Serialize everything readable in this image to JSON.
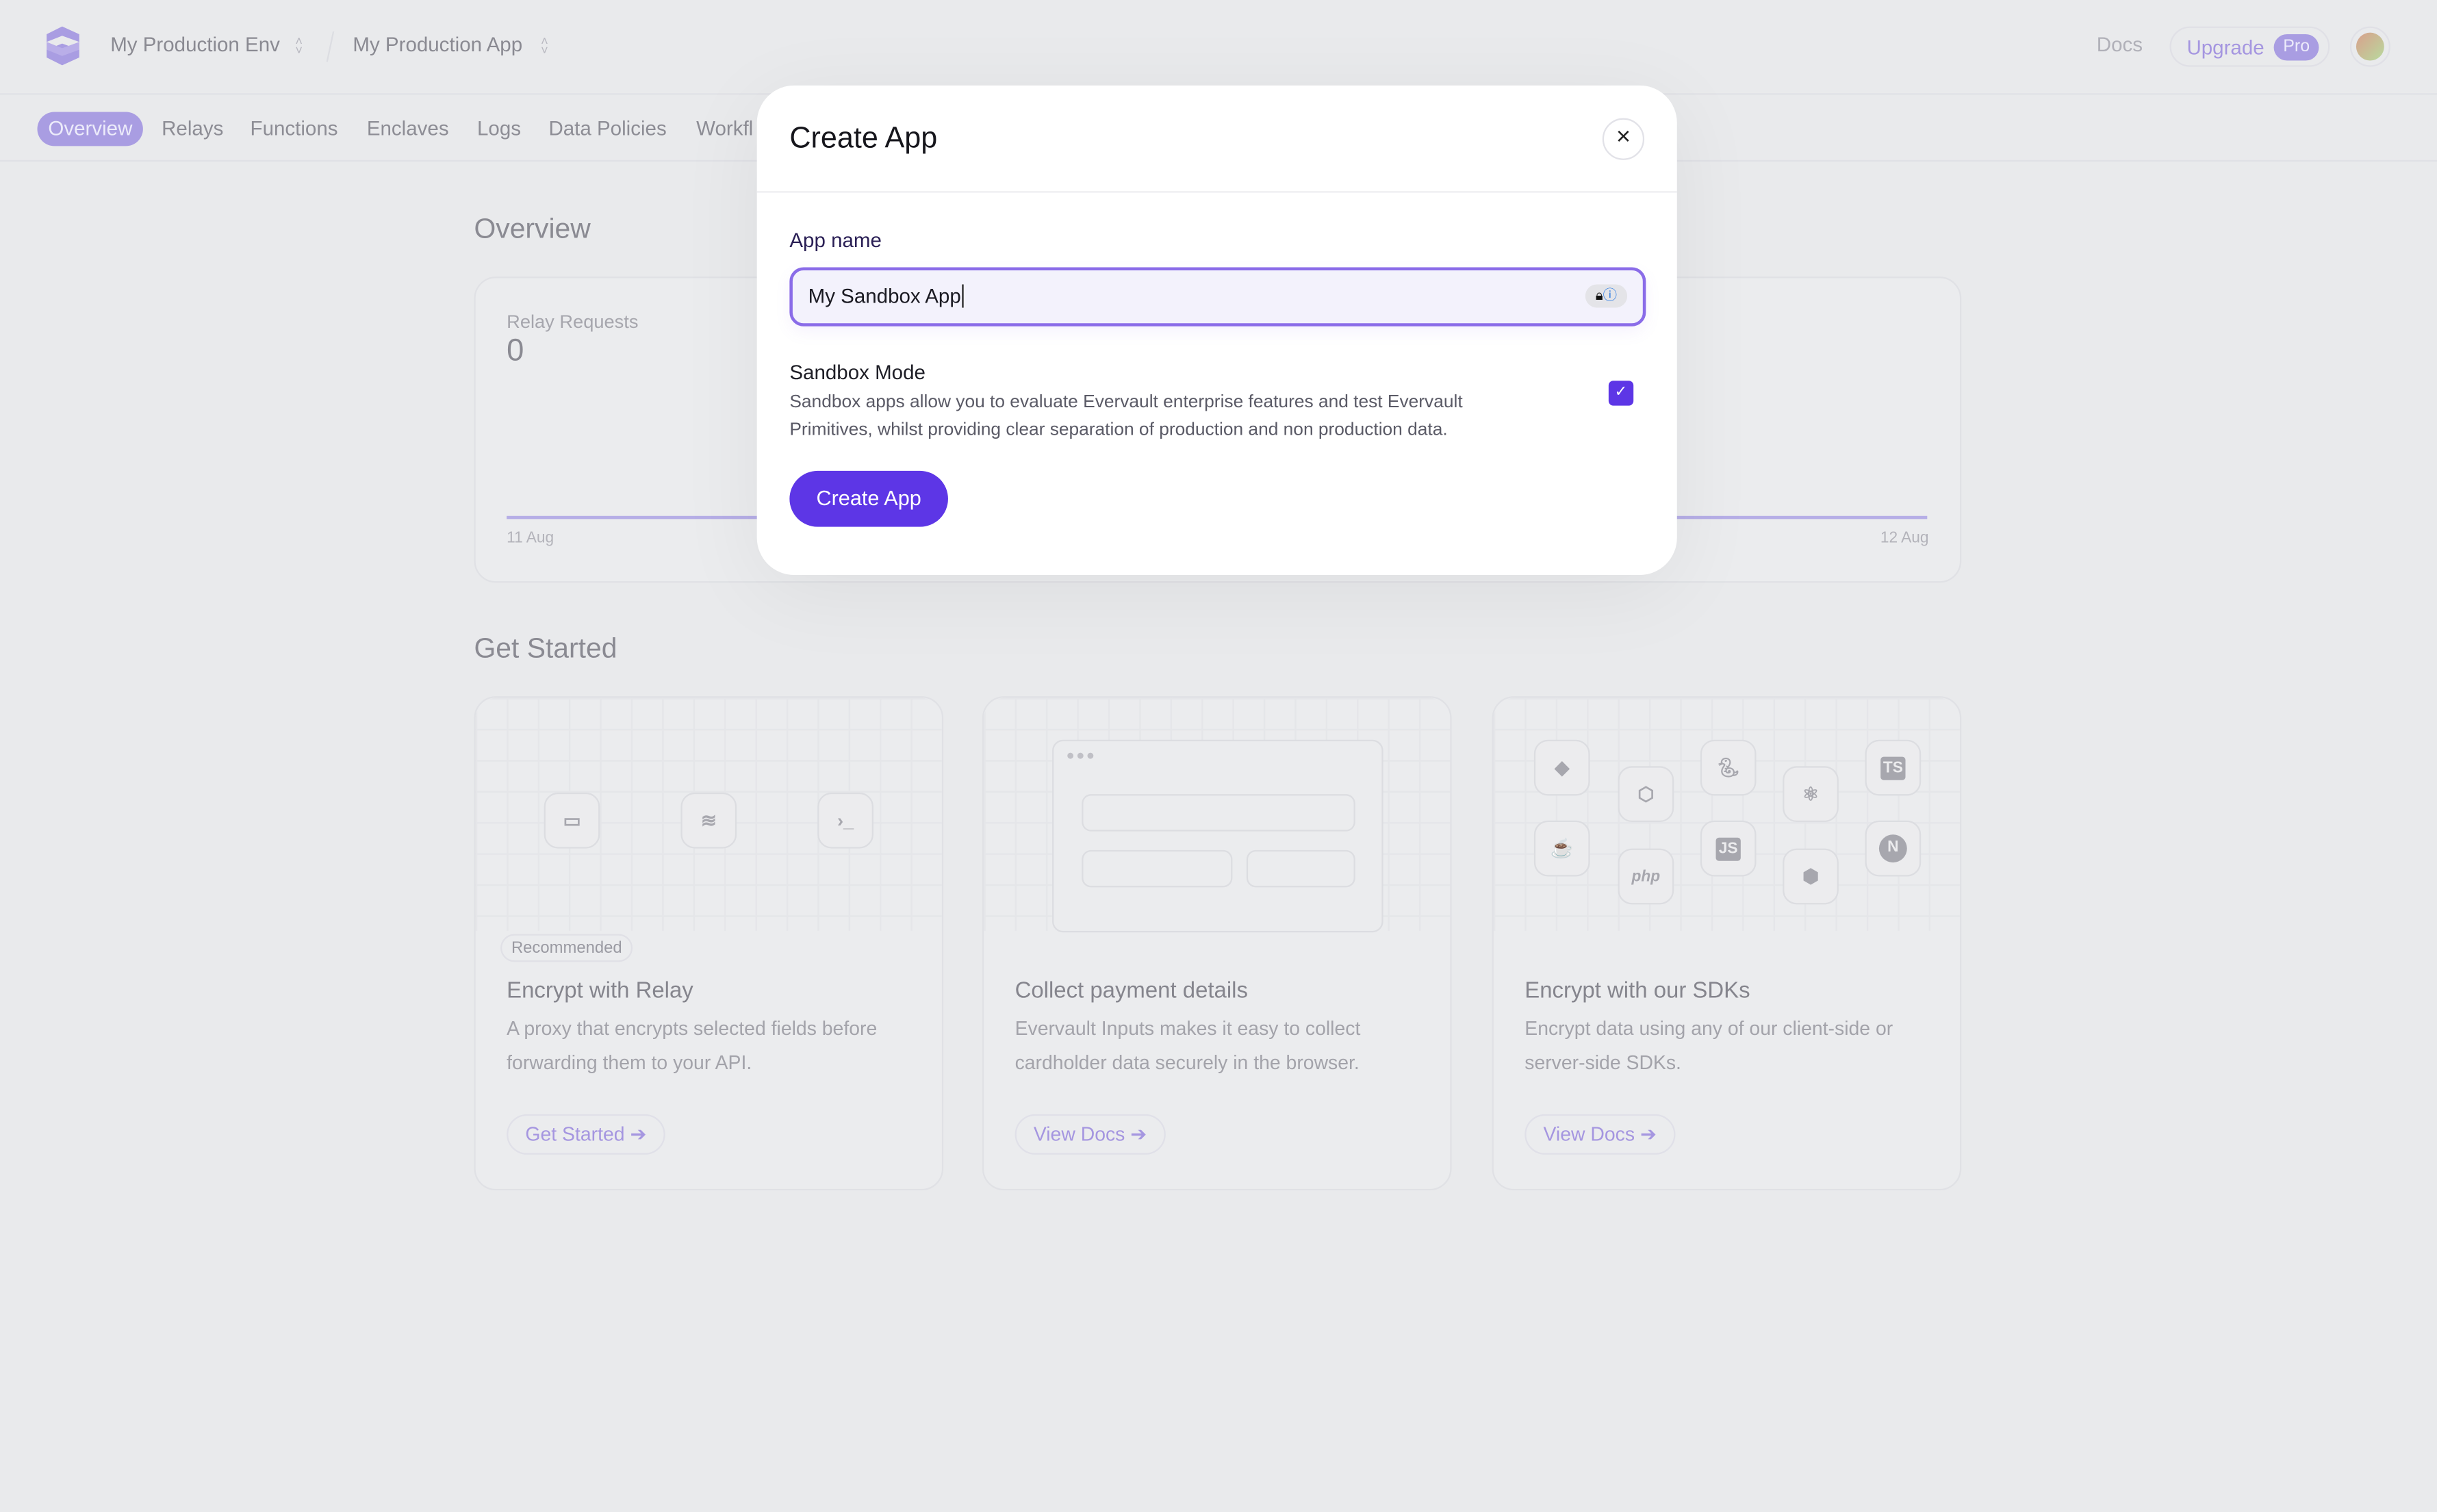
{
  "header": {
    "env": "My Production Env",
    "app": "My Production App",
    "docs": "Docs",
    "upgrade": "Upgrade",
    "pro_badge": "Pro"
  },
  "nav": {
    "items": [
      "Overview",
      "Relays",
      "Functions",
      "Enclaves",
      "Logs",
      "Data Policies",
      "Workfl"
    ],
    "active": "Overview"
  },
  "overview": {
    "title": "Overview",
    "stat_label": "Relay Requests",
    "stat_value": "0",
    "x_start": "11 Aug",
    "x_end": "12 Aug"
  },
  "get_started": {
    "title": "Get Started",
    "cards": [
      {
        "badge": "Recommended",
        "title": "Encrypt with Relay",
        "desc": "A proxy that encrypts selected fields before forwarding them to your API.",
        "button": "Get Started"
      },
      {
        "title": "Collect payment details",
        "desc": "Evervault Inputs makes it easy to collect cardholder data securely in the browser.",
        "button": "View Docs"
      },
      {
        "title": "Encrypt with our SDKs",
        "desc": "Encrypt data using any of our client-side or server-side SDKs.",
        "button": "View Docs"
      }
    ],
    "sdk_labels": {
      "node": "JS",
      "ts": "TS",
      "js": "JS",
      "php": "php",
      "next": "N"
    }
  },
  "modal": {
    "title": "Create App",
    "app_name_label": "App name",
    "app_name_value": "My Sandbox App",
    "sandbox_title": "Sandbox Mode",
    "sandbox_desc_1": "Sandbox apps allow you to evaluate Evervault enterprise features and test Evervault",
    "sandbox_desc_2": "Primitives, whilst providing clear separation of production and non production data.",
    "sandbox_checked": true,
    "submit": "Create App",
    "close": "×"
  },
  "colors": {
    "accent": "#5d36e6",
    "input_border": "#8a6ce8",
    "muted_accent": "#a99de2"
  }
}
